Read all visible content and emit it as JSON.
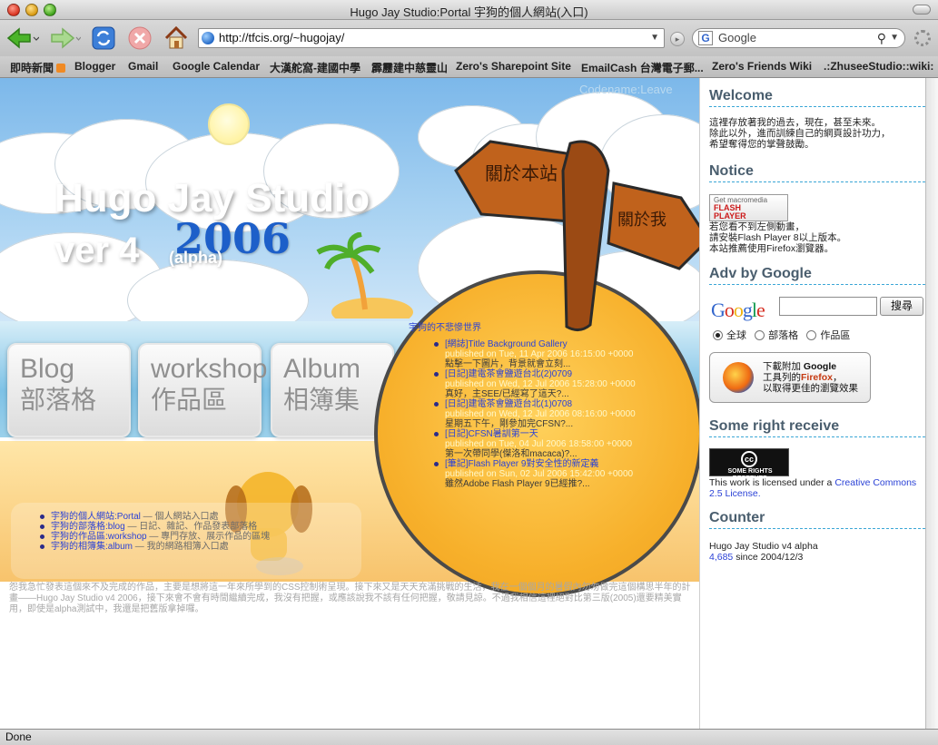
{
  "window": {
    "title": "Hugo Jay Studio:Portal 宇狗的個人網站(入口)"
  },
  "toolbar": {
    "url": "http://tfcis.org/~hugojay/",
    "search_placeholder": "Google"
  },
  "bookmarks": [
    "即時新聞",
    "Blogger",
    "Gmail",
    "Google Calendar",
    "大漢舵窩-建國中學",
    "霹靂建中慈靈山",
    "Zero's Sharepoint Site",
    "EmailCash 台灣電子郵...",
    "Zero's Friends Wiki",
    ".:ZhuseeStudio::wiki:"
  ],
  "hero": {
    "codename": "Codename:Leave",
    "title": "Hugo Jay Studio",
    "version": "ver 4",
    "year": "2006",
    "alpha": "(alpha)"
  },
  "nav": [
    {
      "en": "Blog",
      "zh": "部落格"
    },
    {
      "en": "workshop",
      "zh": "作品區"
    },
    {
      "en": "Album",
      "zh": "相簿集"
    }
  ],
  "signs": {
    "about_site": "關於本站",
    "about_me": "關於我"
  },
  "blog": {
    "heading": "宇狗的不悲慘世界",
    "posts": [
      {
        "title": "[網誌]Title Background Gallery",
        "meta": "published on Tue, 11 Apr 2006 16:15:00 +0000",
        "summary": "點擊一下圖片，背景就會立刻..."
      },
      {
        "title": "[日記]建電茶會鹽遊台北(2)0709",
        "meta": "published on Wed, 12 Jul 2006 15:28:00 +0000",
        "summary": "真好，主SEE/已經寫了這天?..."
      },
      {
        "title": "[日記]建電茶會鹽遊台北(1)0708",
        "meta": "published on Wed, 12 Jul 2006 08:16:00 +0000",
        "summary": "星期五下午，剛參加完CFSN?..."
      },
      {
        "title": "[日記]CFSN暑訓第一天",
        "meta": "published on Tue, 04 Jul 2006 18:58:00 +0000",
        "summary": "第一次帶同學(傑洛和macaca)?..."
      },
      {
        "title": "[筆記]Flash Player 9對安全性的新定義",
        "meta": "published on Sun, 02 Jul 2006 15:42:00 +0000",
        "summary": "雖然Adobe Flash Player 9已經推?..."
      }
    ]
  },
  "links": [
    {
      "a": "宇狗的個人網站:Portal",
      "d": " — 個人網站入口處"
    },
    {
      "a": "宇狗的部落格:blog",
      "d": " — 日記、雜記、作品發表部落格"
    },
    {
      "a": "宇狗的作品區:workshop",
      "d": " — 專門存放、展示作品的區塊"
    },
    {
      "a": "宇狗的相簿集:album",
      "d": " — 我的網路相簿入口處"
    }
  ],
  "intro": "怨我急忙發表這個來不及完成的作品，主要是想將這一年來所學到的CSS控制術呈現。接下來又是天天充滿挑戰的生活，我在一個個月的暑假內勿匆做完這個構思半年的計畫——Hugo Jay Studio v4 2006，接下來會不會有時間繼續完成，我沒有把握，或應該說我不該有任何把握，敬請見諒。不過我相信這裡絕對比第三版(2005)還要精美實用，即使是alpha測試中，我還是把舊版拿掉囉。",
  "sidebar": {
    "welcome_h": "Welcome",
    "welcome_t": [
      "這裡存放著我的過去，現在，甚至未來。",
      "除此以外，進而訓練自己的網頁設計功力，",
      "希望奪得您的掌聲鼓勵。"
    ],
    "notice_h": "Notice",
    "flash_1": "Get macromedia",
    "flash_2": "FLASH",
    "flash_3": "PLAYER",
    "notice_t": [
      "若您看不到左側動畫，",
      "請安裝Flash Player 8以上版本。",
      "本站推薦使用Firefox瀏覽器。"
    ],
    "adv_h": "Adv by Google",
    "google_logo": "Google",
    "search_btn": "搜尋",
    "radios": [
      "全球",
      "部落格",
      "作品區"
    ],
    "ff_1": "下載附加",
    "ff_1b": "Google",
    "ff_2": "工具列的",
    "ff_2b": "Firefox",
    "ff_2c": "，",
    "ff_3": "以取得更佳的瀏覽效果",
    "rights_h": "Some right receive",
    "cc_symbol": "cc",
    "cc_label": "SOME RIGHTS RESERVED",
    "license_pre": "This work is licensed under a ",
    "license_link": "Creative Commons 2.5 License.",
    "counter_h": "Counter",
    "counter_name": "Hugo Jay Studio v4 alpha",
    "counter_num": "4,685",
    "counter_since": " since 2004/12/3"
  },
  "status": "Done"
}
